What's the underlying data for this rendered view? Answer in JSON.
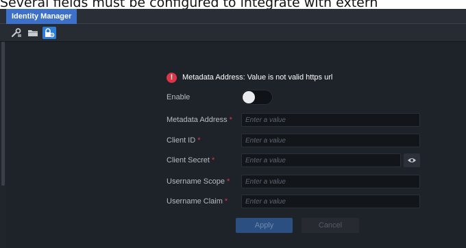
{
  "caption": "Several fields must be configured to integrate with extern",
  "window": {
    "tab_label": "Identity Manager",
    "toolbar": {
      "icons": [
        "wrench-icon",
        "folder-icon",
        "lock-settings-icon"
      ],
      "active_index": 2
    }
  },
  "form": {
    "error_message": "Metadata Address: Value is not valid https url",
    "enable": {
      "label": "Enable",
      "value": false
    },
    "fields": [
      {
        "label": "Metadata Address",
        "required": "*",
        "placeholder": "Enter a value",
        "value": ""
      },
      {
        "label": "Client ID",
        "required": "*",
        "placeholder": "Enter a value",
        "value": ""
      },
      {
        "label": "Client Secret",
        "required": "*",
        "placeholder": "Enter a value",
        "value": ""
      },
      {
        "label": "Username Scope",
        "required": "*",
        "placeholder": "Enter a value",
        "value": ""
      },
      {
        "label": "Username Claim",
        "required": "*",
        "placeholder": "Enter a value",
        "value": ""
      }
    ],
    "apply_label": "Apply",
    "cancel_label": "Cancel"
  },
  "colors": {
    "accent": "#3c70c9",
    "error": "#d9364a",
    "background": "#1e2229"
  }
}
